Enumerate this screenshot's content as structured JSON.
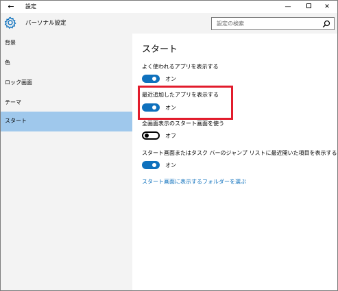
{
  "window": {
    "title": "設定"
  },
  "titlebar": {
    "back_glyph": "←",
    "minimize_glyph": "—",
    "close_glyph": "✕"
  },
  "header": {
    "title": "パーソナル設定"
  },
  "search": {
    "placeholder": "設定の検索"
  },
  "sidebar": {
    "items": [
      {
        "label": "背景"
      },
      {
        "label": "色"
      },
      {
        "label": "ロック画面"
      },
      {
        "label": "テーマ"
      },
      {
        "label": "スタート"
      }
    ],
    "selected_index": 4
  },
  "main": {
    "title": "スタート",
    "settings": [
      {
        "label": "よく使われるアプリを表示する",
        "state": "オン",
        "on": true
      },
      {
        "label": "最近追加したアプリを表示する",
        "state": "オン",
        "on": true
      },
      {
        "label": "全画面表示のスタート画面を使う",
        "state": "オフ",
        "on": false
      },
      {
        "label": "スタート画面またはタスク バーのジャンプ リストに最近開いた項目を表示する",
        "state": "オン",
        "on": true
      }
    ],
    "link": "スタート画面に表示するフォルダーを選ぶ"
  },
  "colors": {
    "accent": "#0f71bd",
    "selected_nav": "#9fc8ec",
    "highlight": "#e21c2c",
    "pane": "#f3f3f3"
  }
}
